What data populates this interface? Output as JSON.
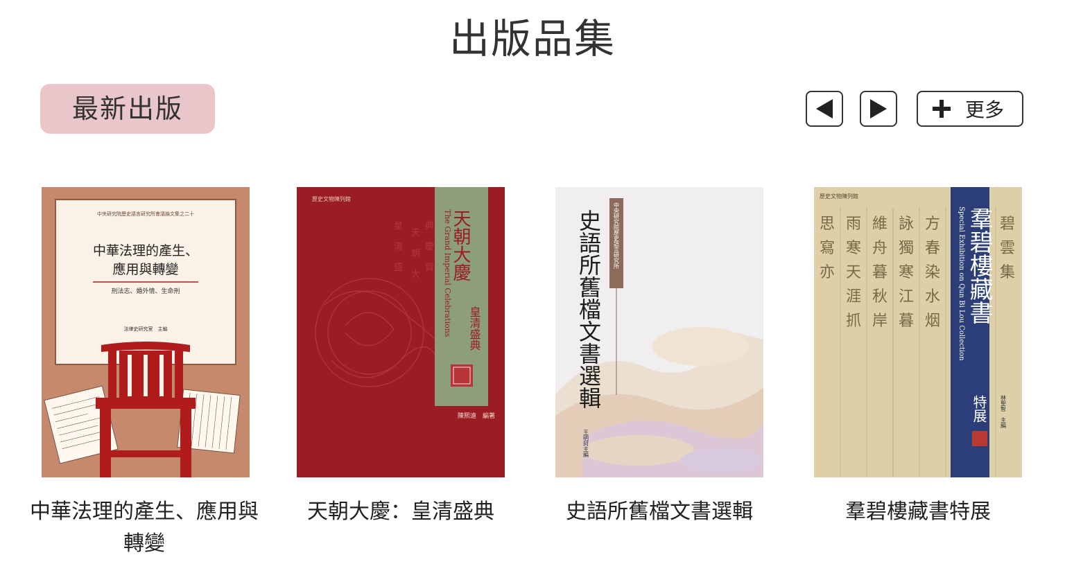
{
  "page": {
    "title": "出版品集"
  },
  "section": {
    "label": "最新出版"
  },
  "controls": {
    "prev_icon": "triangle-left-icon",
    "next_icon": "triangle-right-icon",
    "more_icon": "plus-icon",
    "more_label": "更多"
  },
  "books": [
    {
      "title": "中華法理的產生、應用與轉變",
      "cover": {
        "series": "中央研究院歷史語言研究所會議論文集之二十",
        "title_line1": "中華法理的產生、",
        "title_line2": "應用與轉變",
        "subtitle": "刑法志、婚外情、生命刑",
        "editor": "法律史研究室　主編"
      }
    },
    {
      "title": "天朝大慶：皇清盛典",
      "cover": {
        "publisher": "歷史文物陳列館",
        "title_cn": "天朝大慶",
        "title_en": "The Grand Imperial Celebrations",
        "subtitle": "皇清盛典",
        "author": "陳熙遠　編著"
      }
    },
    {
      "title": "史語所舊檔文書選輯",
      "cover": {
        "institute": "中央研究院歷史語言研究所",
        "title": "史語所舊檔文書選輯",
        "editor": "王明珂主編"
      }
    },
    {
      "title": "羣碧樓藏書特展",
      "cover": {
        "publisher": "歷史文物陳列館",
        "title_cn": "羣碧樓藏書",
        "title_en": "Special Exhibition on Qun Bi Lou Collection",
        "subtitle": "特展",
        "editor": "林聖智　主編"
      }
    }
  ],
  "colors": {
    "pill_bg": "#e8c6ca",
    "book1_bg": "#c58a6e",
    "book1_red": "#b01c1c",
    "book2_bg": "#9b1d24",
    "book2_band": "#8d9e7a",
    "book3_bg": "#f1eef0",
    "book4_bg": "#ddd0a8",
    "book4_band": "#2b3e78"
  }
}
